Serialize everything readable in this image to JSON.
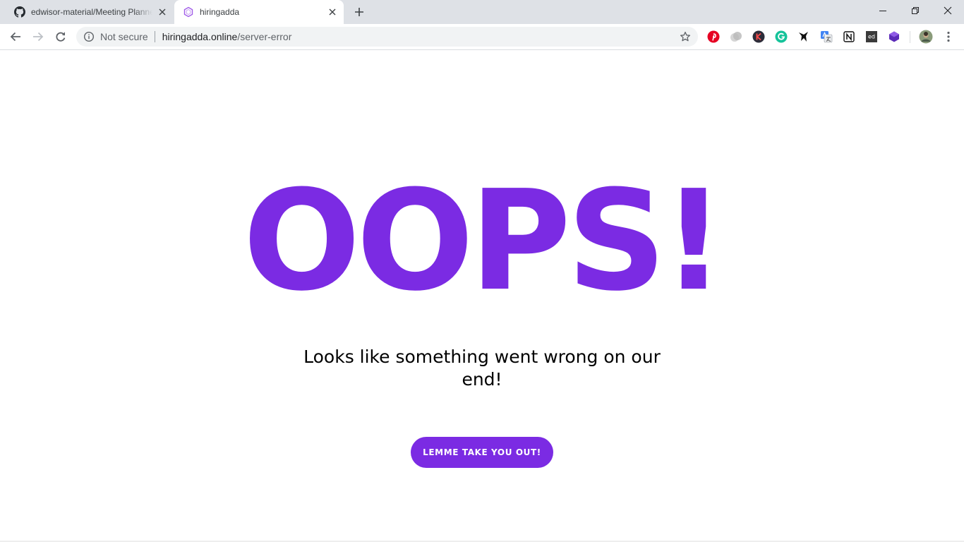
{
  "tabs": [
    {
      "title": "edwisor-material/Meeting Planner",
      "icon": "github-icon",
      "active": false
    },
    {
      "title": "hiringadda",
      "icon": "hiringadda-logo-icon",
      "active": true
    }
  ],
  "address_bar": {
    "security_label": "Not secure",
    "host": "hiringadda.online",
    "path": "/server-error"
  },
  "extensions": [
    "pinterest-icon",
    "extension-icon",
    "k-extension-icon",
    "grammarly-icon",
    "bird-extension-icon",
    "google-translate-icon",
    "notion-icon",
    "ed-extension-icon",
    "purple-cube-extension-icon"
  ],
  "page": {
    "headline": "OOPS!",
    "message": "Looks like something went wrong on our end!",
    "button_label": "LEMME TAKE YOU OUT!"
  },
  "colors": {
    "accent": "#7b2be3",
    "tabstrip": "#dee1e6",
    "omnibox": "#f1f3f4"
  }
}
